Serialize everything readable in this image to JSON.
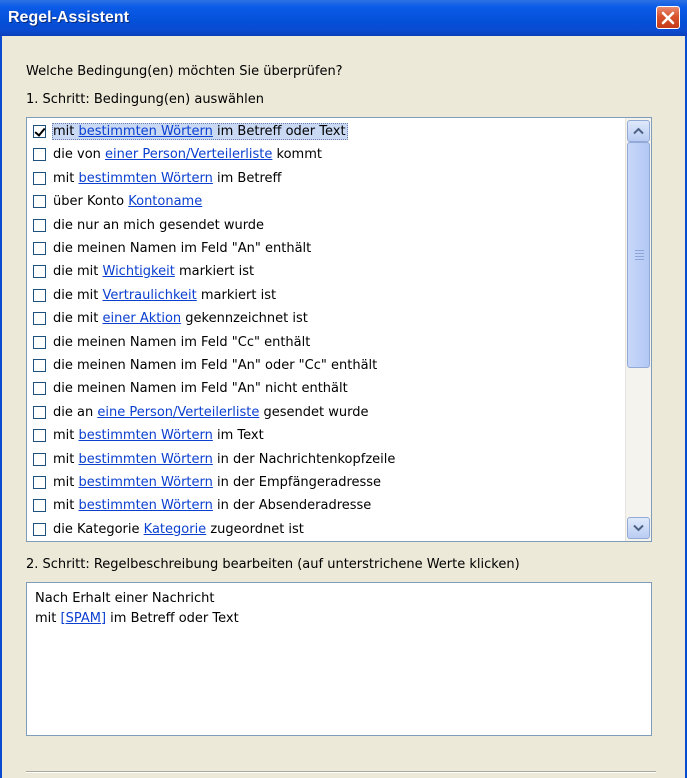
{
  "window": {
    "title": "Regel-Assistent"
  },
  "question": "Welche Bedingung(en) möchten Sie überprüfen?",
  "step1": {
    "label": "1. Schritt: Bedingung(en) auswählen"
  },
  "conditions": [
    {
      "before": "mit ",
      "link": "bestimmten Wörtern",
      "after": " im Betreff oder Text",
      "checked": true
    },
    {
      "before": "die von ",
      "link": "einer Person/Verteilerliste",
      "after": " kommt",
      "checked": false
    },
    {
      "before": "mit ",
      "link": "bestimmten Wörtern",
      "after": " im Betreff",
      "checked": false
    },
    {
      "before": "über Konto ",
      "link": "Kontoname",
      "after": "",
      "checked": false
    },
    {
      "before": "die nur an mich gesendet wurde",
      "link": "",
      "after": "",
      "checked": false
    },
    {
      "before": "die meinen Namen im Feld \"An\" enthält",
      "link": "",
      "after": "",
      "checked": false
    },
    {
      "before": "die mit ",
      "link": "Wichtigkeit",
      "after": " markiert ist",
      "checked": false
    },
    {
      "before": "die mit ",
      "link": "Vertraulichkeit",
      "after": " markiert ist",
      "checked": false
    },
    {
      "before": "die mit ",
      "link": "einer Aktion",
      "after": " gekennzeichnet ist",
      "checked": false
    },
    {
      "before": "die meinen Namen im Feld \"Cc\" enthält",
      "link": "",
      "after": "",
      "checked": false
    },
    {
      "before": "die meinen Namen im Feld \"An\" oder \"Cc\" enthält",
      "link": "",
      "after": "",
      "checked": false
    },
    {
      "before": "die meinen Namen im Feld \"An\" nicht enthält",
      "link": "",
      "after": "",
      "checked": false
    },
    {
      "before": "die an ",
      "link": "eine Person/Verteilerliste",
      "after": " gesendet wurde",
      "checked": false
    },
    {
      "before": "mit ",
      "link": "bestimmten Wörtern",
      "after": " im Text",
      "checked": false
    },
    {
      "before": "mit ",
      "link": "bestimmten Wörtern",
      "after": " in der Nachrichtenkopfzeile",
      "checked": false
    },
    {
      "before": "mit ",
      "link": "bestimmten Wörtern",
      "after": " in der Empfängeradresse",
      "checked": false
    },
    {
      "before": "mit ",
      "link": "bestimmten Wörtern",
      "after": " in der Absenderadresse",
      "checked": false
    },
    {
      "before": "die Kategorie ",
      "link": "Kategorie",
      "after": " zugeordnet ist",
      "checked": false
    }
  ],
  "step2": {
    "label": "2. Schritt: Regelbeschreibung bearbeiten (auf unterstrichene Werte klicken)"
  },
  "description": {
    "line1": "Nach Erhalt einer Nachricht",
    "line2_before": "mit ",
    "line2_link": "[SPAM]",
    "line2_after": " im Betreff oder Text"
  },
  "icons": {
    "close": "close-x-icon",
    "scroll_up": "arrow-up-icon",
    "scroll_down": "arrow-down-icon"
  },
  "colors": {
    "titlebar": "#0450d8",
    "link": "#0a3fd0",
    "close": "#d9542e",
    "dialog": "#ece9d8"
  }
}
